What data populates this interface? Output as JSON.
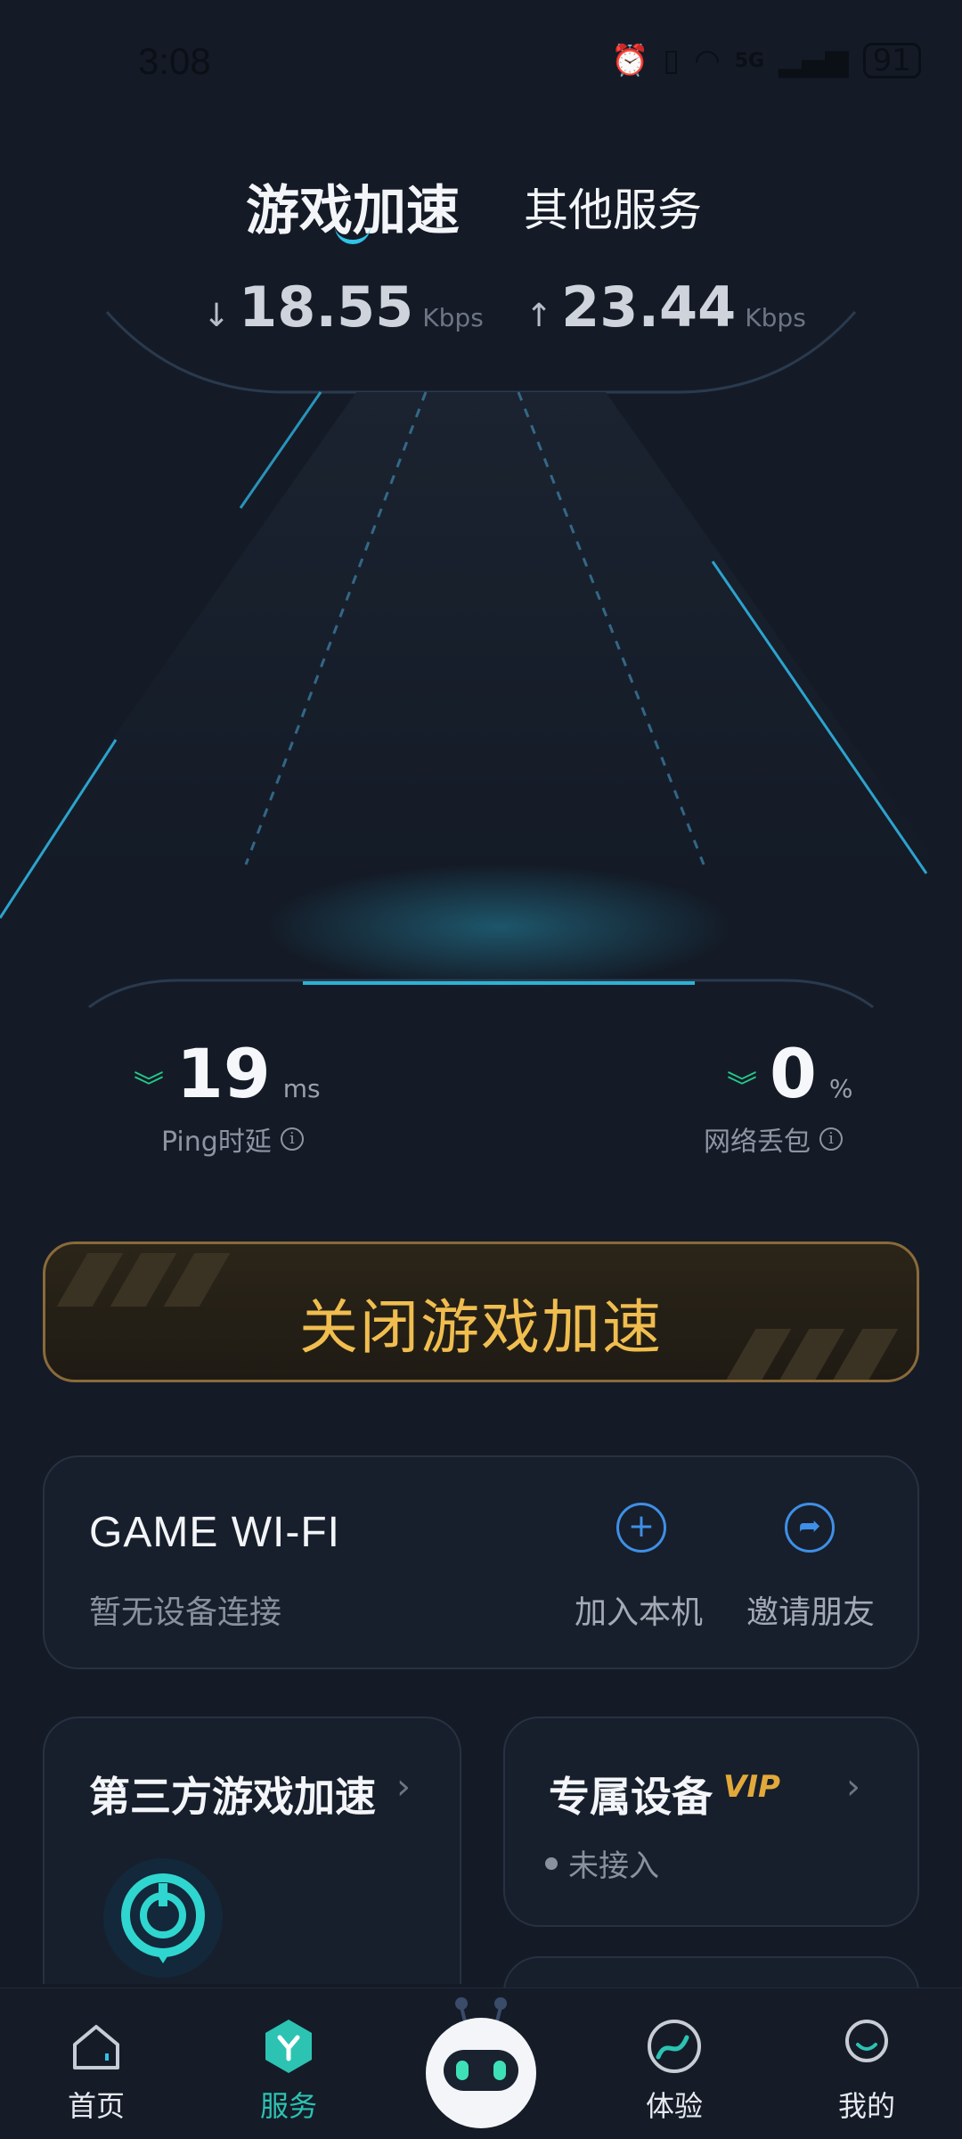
{
  "status_bar": {
    "time": "3:08",
    "battery": "91",
    "network": "5G"
  },
  "tabs": [
    {
      "label": "游戏加速",
      "active": true
    },
    {
      "label": "其他服务",
      "active": false
    }
  ],
  "speed": {
    "download_value": "18.55",
    "download_unit": "Kbps",
    "upload_value": "23.44",
    "upload_unit": "Kbps"
  },
  "metrics": {
    "ping": {
      "value": "19",
      "unit": "ms",
      "label": "Ping时延"
    },
    "packet_loss": {
      "value": "0",
      "unit": "%",
      "label": "网络丢包"
    }
  },
  "close_button": {
    "label": "关闭游戏加速"
  },
  "game_wifi": {
    "title": "GAME WI-FI",
    "status": "暂无设备连接",
    "join_label": "加入本机",
    "invite_label": "邀请朋友"
  },
  "third_party": {
    "title": "第三方游戏加速"
  },
  "exclusive_device": {
    "title": "专属设备",
    "badge": "VIP",
    "status": "未接入"
  },
  "nav": [
    {
      "label": "首页",
      "icon": "home-icon"
    },
    {
      "label": "服务",
      "icon": "service-icon",
      "active": true
    },
    {
      "label": "",
      "icon": "robot-assistant-icon"
    },
    {
      "label": "体验",
      "icon": "experience-icon"
    },
    {
      "label": "我的",
      "icon": "profile-icon"
    }
  ],
  "colors": {
    "background": "#141b27",
    "accent_cyan": "#2fc3e8",
    "gold": "#f0bd4f",
    "green": "#25c88a",
    "blue": "#3f8fe6",
    "nav_active": "#2cc3b3"
  }
}
